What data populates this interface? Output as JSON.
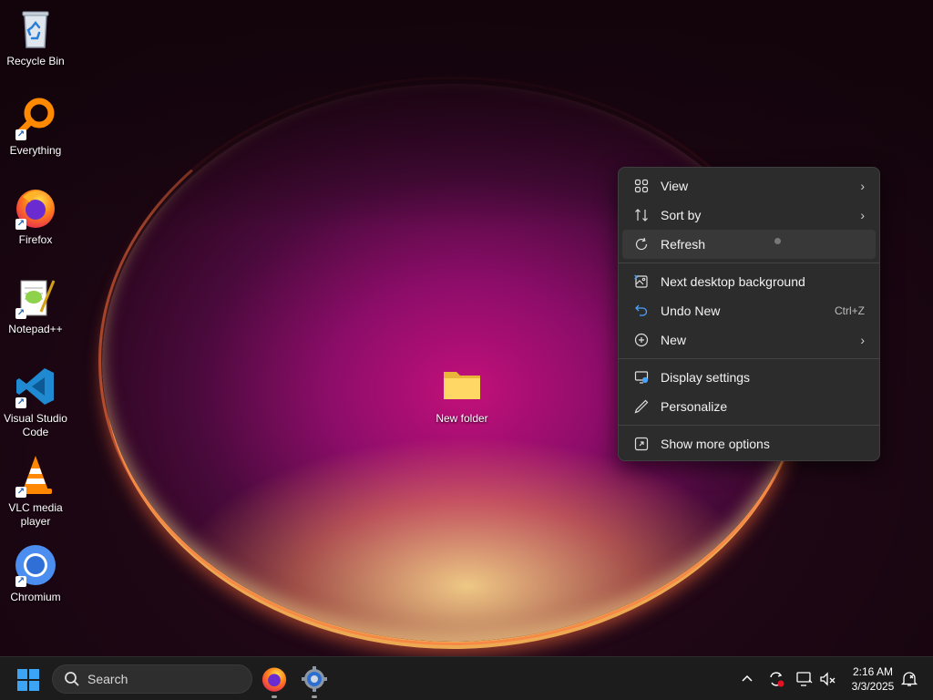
{
  "desktop": {
    "icons": [
      {
        "label": "Recycle Bin",
        "icon": "recycle-bin-icon"
      },
      {
        "label": "Everything",
        "icon": "everything-search-icon"
      },
      {
        "label": "Firefox",
        "icon": "firefox-icon"
      },
      {
        "label": "Notepad++",
        "icon": "notepad-plus-plus-icon"
      },
      {
        "label": "Visual Studio Code",
        "icon": "vscode-icon"
      },
      {
        "label": "VLC media player",
        "icon": "vlc-icon"
      },
      {
        "label": "Chromium",
        "icon": "chromium-icon"
      }
    ],
    "folder": {
      "label": "New folder",
      "icon": "folder-icon"
    }
  },
  "context_menu": {
    "items": [
      {
        "label": "View",
        "icon": "view-grid-icon",
        "submenu": true
      },
      {
        "label": "Sort by",
        "icon": "sort-icon",
        "submenu": true
      },
      {
        "label": "Refresh",
        "icon": "refresh-icon",
        "highlighted": true
      },
      {
        "label": "Next desktop background",
        "icon": "next-background-icon"
      },
      {
        "label": "Undo New",
        "icon": "undo-icon",
        "shortcut": "Ctrl+Z"
      },
      {
        "label": "New",
        "icon": "new-plus-icon",
        "submenu": true
      },
      {
        "label": "Display settings",
        "icon": "display-settings-icon"
      },
      {
        "label": "Personalize",
        "icon": "personalize-pen-icon"
      },
      {
        "label": "Show more options",
        "icon": "show-more-options-icon"
      }
    ]
  },
  "taskbar": {
    "search_placeholder": "Search",
    "pinned": [
      "firefox-icon",
      "settings-gear-icon"
    ],
    "tray": [
      "chevron-up-icon",
      "sync-alert-icon",
      "network-monitor-icon",
      "volume-muted-icon",
      "notification-icon"
    ],
    "time": "2:16 AM",
    "date": "3/3/2025"
  },
  "colors": {
    "menu_bg": "#2c2c2c",
    "taskbar_bg": "#1c1c1c",
    "accent": "#0078d4"
  }
}
